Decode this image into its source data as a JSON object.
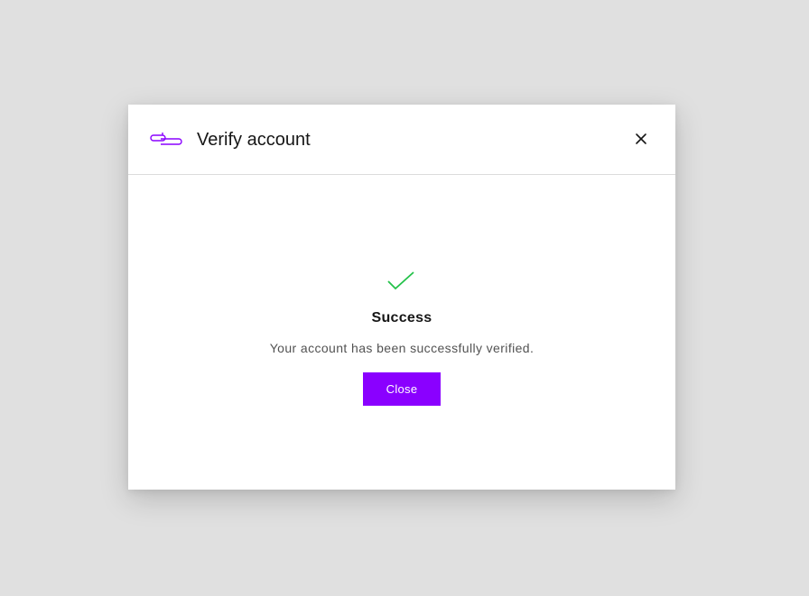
{
  "modal": {
    "title": "Verify account",
    "logo_icon": "app-logo-icon",
    "close_icon": "close-icon"
  },
  "result": {
    "status_icon": "checkmark-icon",
    "title": "Success",
    "message": "Your account has been successfully verified.",
    "button_label": "Close"
  },
  "colors": {
    "accent": "#8a00ff",
    "success": "#24c24a",
    "backdrop": "#e0e0e0"
  }
}
